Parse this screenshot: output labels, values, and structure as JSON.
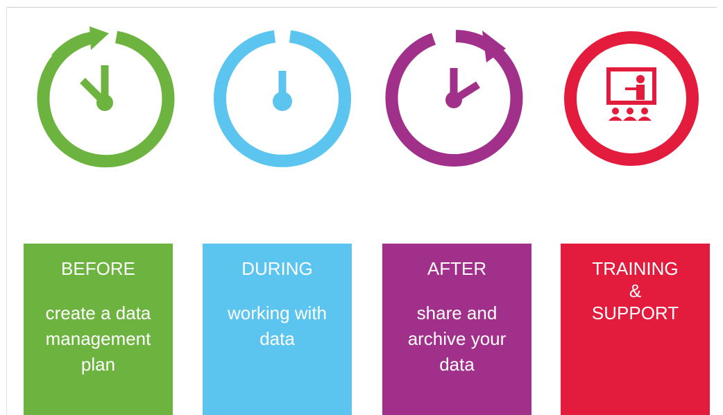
{
  "colors": {
    "before": "#6db33f",
    "during": "#5bc4ef",
    "after": "#a0308a",
    "training": "#e31c3d"
  },
  "stages": [
    {
      "key": "before",
      "icon": "clock-arrow-icon",
      "title": "BEFORE",
      "description": "create a data\nmanagement\nplan"
    },
    {
      "key": "during",
      "icon": "stopwatch-icon",
      "title": "DURING",
      "description": "working with\ndata"
    },
    {
      "key": "after",
      "icon": "clock-arrow-icon",
      "title": "AFTER",
      "description": "share and\narchive your\ndata"
    },
    {
      "key": "training",
      "icon": "presentation-icon",
      "title": "TRAINING\n&\nSUPPORT",
      "description": ""
    }
  ]
}
